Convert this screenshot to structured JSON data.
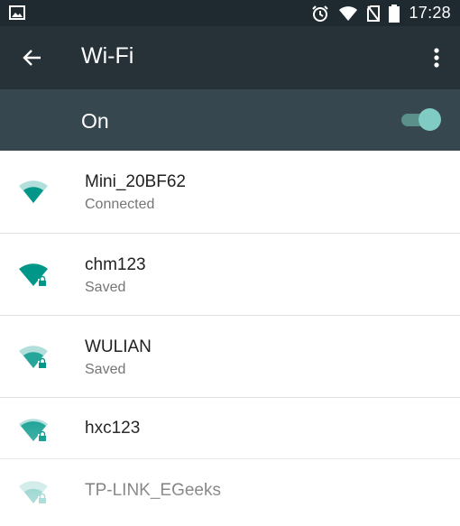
{
  "status_bar": {
    "time": "17:28",
    "icons": [
      "image-icon",
      "alarm-icon",
      "wifi-signal-icon",
      "no-sim-icon",
      "battery-icon"
    ]
  },
  "toolbar": {
    "title": "Wi-Fi",
    "back_icon": "arrow-back-icon",
    "more_icon": "more-vert-icon"
  },
  "wifi_switch": {
    "label": "On",
    "enabled": true
  },
  "networks": [
    {
      "ssid": "Mini_20BF62",
      "status": "Connected",
      "secured": false
    },
    {
      "ssid": "chm123",
      "status": "Saved",
      "secured": true
    },
    {
      "ssid": "WULIAN",
      "status": "Saved",
      "secured": true
    },
    {
      "ssid": "hxc123",
      "status": "",
      "secured": true
    },
    {
      "ssid": "TP-LINK_EGeeks",
      "status": "",
      "secured": true
    }
  ],
  "colors": {
    "status_bar": "#1f2a30",
    "toolbar": "#263238",
    "switch_bar": "#37474f",
    "accent": "#009688",
    "switch_thumb": "#80cbc4"
  }
}
